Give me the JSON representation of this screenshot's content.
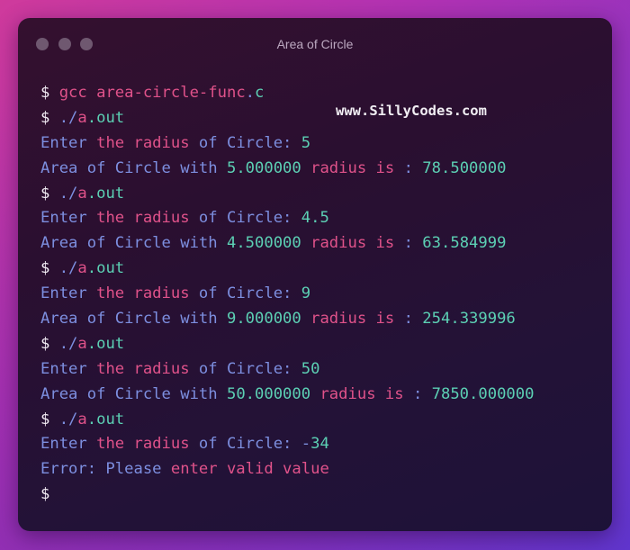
{
  "window": {
    "title": "Area of Circle",
    "traffic_lights": [
      "close",
      "minimize",
      "zoom"
    ]
  },
  "watermark": "www.SillyCodes.com",
  "colors": {
    "prompt": "#f2ecf4",
    "blue": "#7d8fe0",
    "pink": "#e0528a",
    "teal": "#5cd0b4",
    "title": "#bba8c0"
  },
  "terminal": {
    "lines": [
      {
        "type": "command",
        "segments": [
          {
            "t": "$",
            "c": "dollar"
          },
          {
            "t": " gcc area-circle-func",
            "c": "pink"
          },
          {
            "t": ".",
            "c": "blue"
          },
          {
            "t": "c",
            "c": "teal"
          }
        ]
      },
      {
        "type": "command",
        "segments": [
          {
            "t": "$",
            "c": "dollar"
          },
          {
            "t": " ./",
            "c": "blue"
          },
          {
            "t": "a",
            "c": "pink"
          },
          {
            "t": ".out",
            "c": "teal"
          }
        ]
      },
      {
        "type": "output",
        "segments": [
          {
            "t": "Enter ",
            "c": "blue"
          },
          {
            "t": "the radius",
            "c": "pink"
          },
          {
            "t": " of Circle: ",
            "c": "blue"
          },
          {
            "t": "5",
            "c": "teal"
          }
        ]
      },
      {
        "type": "output",
        "segments": [
          {
            "t": "Area of Circle with ",
            "c": "blue"
          },
          {
            "t": "5.000000",
            "c": "teal"
          },
          {
            "t": " radius is ",
            "c": "pink"
          },
          {
            "t": ": ",
            "c": "blue"
          },
          {
            "t": "78.500000",
            "c": "teal"
          }
        ]
      },
      {
        "type": "command",
        "segments": [
          {
            "t": "$",
            "c": "dollar"
          },
          {
            "t": " ./",
            "c": "blue"
          },
          {
            "t": "a",
            "c": "pink"
          },
          {
            "t": ".out",
            "c": "teal"
          }
        ]
      },
      {
        "type": "output",
        "segments": [
          {
            "t": "Enter ",
            "c": "blue"
          },
          {
            "t": "the radius",
            "c": "pink"
          },
          {
            "t": " of Circle: ",
            "c": "blue"
          },
          {
            "t": "4.5",
            "c": "teal"
          }
        ]
      },
      {
        "type": "output",
        "segments": [
          {
            "t": "Area of Circle with ",
            "c": "blue"
          },
          {
            "t": "4.500000",
            "c": "teal"
          },
          {
            "t": " radius is ",
            "c": "pink"
          },
          {
            "t": ": ",
            "c": "blue"
          },
          {
            "t": "63.584999",
            "c": "teal"
          }
        ]
      },
      {
        "type": "command",
        "segments": [
          {
            "t": "$",
            "c": "dollar"
          },
          {
            "t": " ./",
            "c": "blue"
          },
          {
            "t": "a",
            "c": "pink"
          },
          {
            "t": ".out",
            "c": "teal"
          }
        ]
      },
      {
        "type": "output",
        "segments": [
          {
            "t": "Enter ",
            "c": "blue"
          },
          {
            "t": "the radius",
            "c": "pink"
          },
          {
            "t": " of Circle: ",
            "c": "blue"
          },
          {
            "t": "9",
            "c": "teal"
          }
        ]
      },
      {
        "type": "output",
        "segments": [
          {
            "t": "Area of Circle with ",
            "c": "blue"
          },
          {
            "t": "9.000000",
            "c": "teal"
          },
          {
            "t": " radius is ",
            "c": "pink"
          },
          {
            "t": ": ",
            "c": "blue"
          },
          {
            "t": "254.339996",
            "c": "teal"
          }
        ]
      },
      {
        "type": "command",
        "segments": [
          {
            "t": "$",
            "c": "dollar"
          },
          {
            "t": " ./",
            "c": "blue"
          },
          {
            "t": "a",
            "c": "pink"
          },
          {
            "t": ".out",
            "c": "teal"
          }
        ]
      },
      {
        "type": "output",
        "segments": [
          {
            "t": "Enter ",
            "c": "blue"
          },
          {
            "t": "the radius",
            "c": "pink"
          },
          {
            "t": " of Circle: ",
            "c": "blue"
          },
          {
            "t": "50",
            "c": "teal"
          }
        ]
      },
      {
        "type": "output",
        "segments": [
          {
            "t": "Area of Circle with ",
            "c": "blue"
          },
          {
            "t": "50.000000",
            "c": "teal"
          },
          {
            "t": " radius is ",
            "c": "pink"
          },
          {
            "t": ": ",
            "c": "blue"
          },
          {
            "t": "7850.000000",
            "c": "teal"
          }
        ]
      },
      {
        "type": "command",
        "segments": [
          {
            "t": "$",
            "c": "dollar"
          },
          {
            "t": " ./",
            "c": "blue"
          },
          {
            "t": "a",
            "c": "pink"
          },
          {
            "t": ".out",
            "c": "teal"
          }
        ]
      },
      {
        "type": "output",
        "segments": [
          {
            "t": "Enter ",
            "c": "blue"
          },
          {
            "t": "the radius",
            "c": "pink"
          },
          {
            "t": " of Circle: -",
            "c": "blue"
          },
          {
            "t": "34",
            "c": "teal"
          }
        ]
      },
      {
        "type": "output",
        "segments": [
          {
            "t": "Error: Please ",
            "c": "blue"
          },
          {
            "t": "enter valid value",
            "c": "pink"
          }
        ]
      },
      {
        "type": "prompt",
        "segments": [
          {
            "t": "$",
            "c": "dollar"
          }
        ]
      }
    ]
  }
}
